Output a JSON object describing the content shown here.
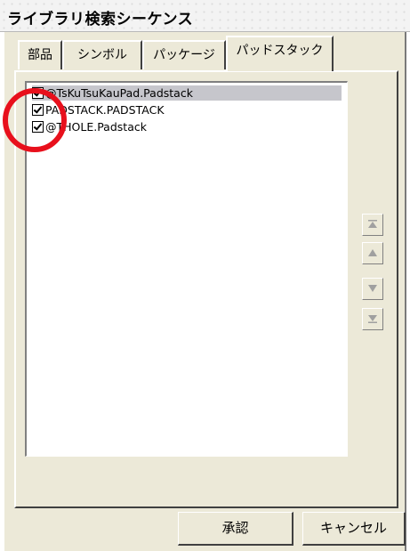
{
  "window": {
    "title": "ライブラリ検索シーケンス"
  },
  "tabs": [
    {
      "label": "部品",
      "active": false
    },
    {
      "label": "シンボル",
      "active": false
    },
    {
      "label": "パッケージ",
      "active": false
    },
    {
      "label": "パッドスタック",
      "active": true
    }
  ],
  "library_list": {
    "items": [
      {
        "label": "@TsKuTsuKauPad.Padstack",
        "checked": true,
        "selected": true
      },
      {
        "label": "PADSTACK.PADSTACK",
        "checked": true,
        "selected": false
      },
      {
        "label": "@THOLE.Padstack",
        "checked": true,
        "selected": false
      }
    ]
  },
  "side_buttons": [
    "move-top-icon",
    "move-up-icon",
    "move-down-icon",
    "move-bottom-icon"
  ],
  "buttons": {
    "ok_label": "承認",
    "cancel_label": "キャンセル"
  },
  "annotation": {
    "highlight_color": "#e8101c"
  }
}
